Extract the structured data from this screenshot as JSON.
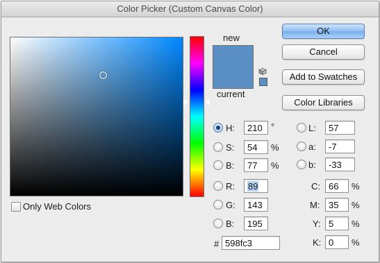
{
  "window": {
    "title": "Color Picker (Custom Canvas Color)"
  },
  "preview": {
    "new_label": "new",
    "current_label": "current",
    "new_color": "#598fc3",
    "current_color": "#598fc3"
  },
  "buttons": {
    "ok": "OK",
    "cancel": "Cancel",
    "add_to_swatches": "Add to Swatches",
    "color_libraries": "Color Libraries"
  },
  "field": {
    "pure_hue_color": "#0088ff"
  },
  "hsb": {
    "h_label": "H:",
    "h_value": "210",
    "h_unit": "°",
    "s_label": "S:",
    "s_value": "54",
    "s_unit": "%",
    "b_label": "B:",
    "b_value": "77",
    "b_unit": "%",
    "selected": "H"
  },
  "rgb": {
    "r_label": "R:",
    "r_value": "89",
    "g_label": "G:",
    "g_value": "143",
    "b_label": "B:",
    "b_value": "195"
  },
  "lab": {
    "l_label": "L:",
    "l_value": "57",
    "a_label": "a:",
    "a_value": "-7",
    "b_label": "b:",
    "b_value": "-33"
  },
  "cmyk": {
    "c_label": "C:",
    "c_value": "66",
    "c_unit": "%",
    "m_label": "M:",
    "m_value": "35",
    "m_unit": "%",
    "y_label": "Y:",
    "y_value": "5",
    "y_unit": "%",
    "k_label": "K:",
    "k_value": "0",
    "k_unit": "%"
  },
  "hex": {
    "label": "#",
    "value": "598fc3"
  },
  "options": {
    "only_web_colors_label": "Only Web Colors",
    "only_web_colors_checked": false
  }
}
